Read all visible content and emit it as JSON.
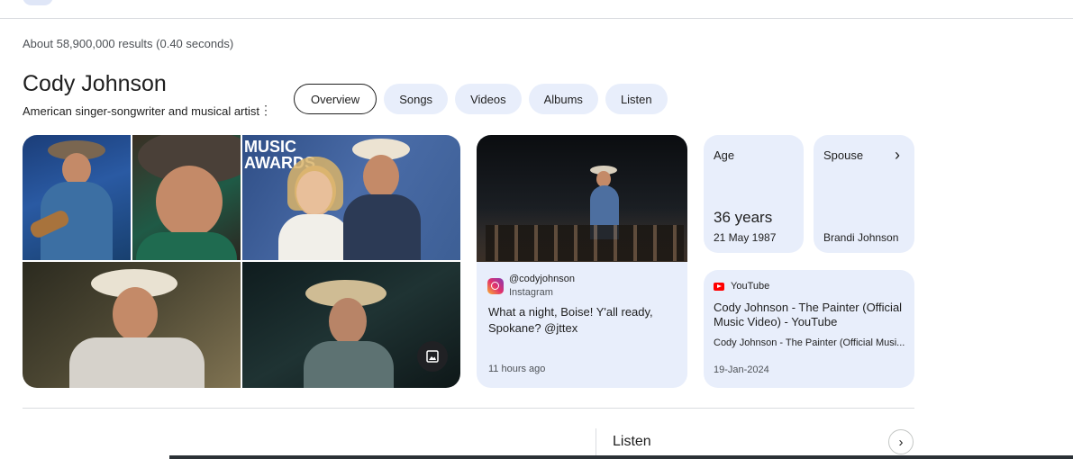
{
  "results_stats": "About 58,900,000 results (0.40 seconds)",
  "entity": {
    "name": "Cody Johnson",
    "description": "American singer-songwriter and musical artist",
    "more_icon": "more-vert-icon"
  },
  "tabs": [
    {
      "label": "Overview",
      "active": true
    },
    {
      "label": "Songs",
      "active": false
    },
    {
      "label": "Videos",
      "active": false
    },
    {
      "label": "Albums",
      "active": false
    },
    {
      "label": "Listen",
      "active": false
    }
  ],
  "gallery": {
    "sign_text_1": "MUSIC",
    "sign_text_2": "AWARDS",
    "image_button_icon": "image-icon"
  },
  "social_post": {
    "handle": "@codyjohnson",
    "source": "Instagram",
    "text": "What a night, Boise! Y'all ready, Spokane? @jttex",
    "time": "11 hours ago"
  },
  "facts": {
    "age": {
      "label": "Age",
      "value": "36 years",
      "detail": "21 May 1987"
    },
    "spouse": {
      "label": "Spouse",
      "value": "Brandi Johnson"
    }
  },
  "video": {
    "source": "YouTube",
    "title": "Cody Johnson - The Painter (Official Music Video) - YouTube",
    "meta": "Cody Johnson - The Painter (Official Musi...",
    "date": "19-Jan-2024"
  },
  "listen_section": {
    "title": "Listen",
    "arrow_icon": "chevron-right-icon"
  },
  "colors": {
    "card_bg": "#e8eefb",
    "text": "#1f1f1f",
    "muted": "#4d5156",
    "divider": "#dadce0"
  }
}
